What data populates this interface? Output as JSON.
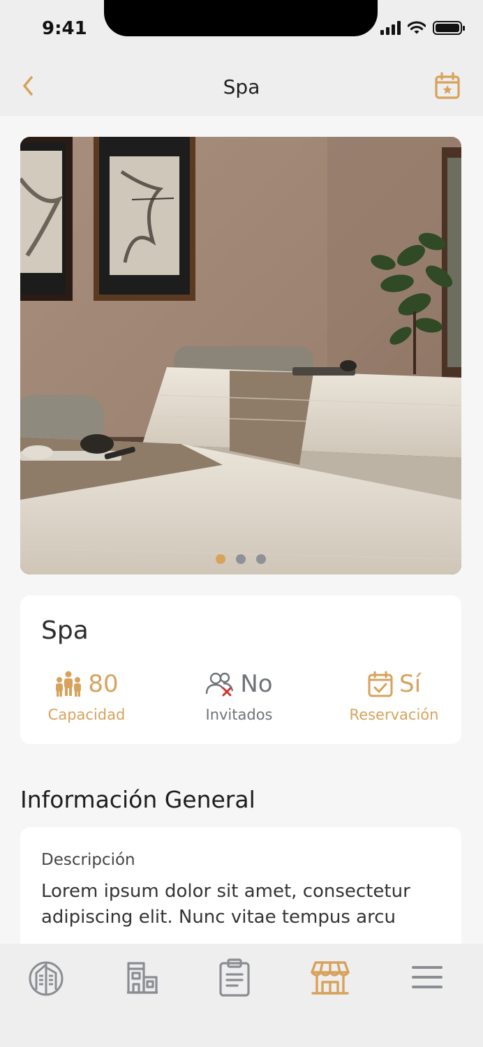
{
  "status_bar": {
    "time": "9:41"
  },
  "nav": {
    "title": "Spa",
    "back_icon": "chevron-left-icon",
    "action_icon": "calendar-star-icon"
  },
  "gallery": {
    "image": "spa-massage-room-photo",
    "slides": 3,
    "active_slide": 1
  },
  "card": {
    "title": "Spa",
    "stats": [
      {
        "value": "80",
        "label": "Capacidad",
        "icon": "people-icon",
        "color": "#d7a25c"
      },
      {
        "value": "No",
        "label": "Invitados",
        "icon": "guests-denied-icon",
        "color": "#6f7378"
      },
      {
        "value": "Sí",
        "label": "Reservación",
        "icon": "calendar-check-icon",
        "color": "#d7a25c"
      }
    ]
  },
  "section": {
    "title": "Información General",
    "description_label": "Descripción",
    "description_text": "Lorem ipsum dolor sit amet, consectetur adipiscing elit. Nunc vitae tempus arcu"
  },
  "tab_bar": {
    "tabs": [
      {
        "icon": "resort-logo-icon",
        "active": false
      },
      {
        "icon": "building-icon",
        "active": false
      },
      {
        "icon": "clipboard-icon",
        "active": false
      },
      {
        "icon": "kiosk-icon",
        "active": true
      },
      {
        "icon": "menu-icon",
        "active": false
      }
    ]
  },
  "colors": {
    "accent": "#d7a25c",
    "inactive": "#8a8d92",
    "background": "#f6f6f6"
  }
}
